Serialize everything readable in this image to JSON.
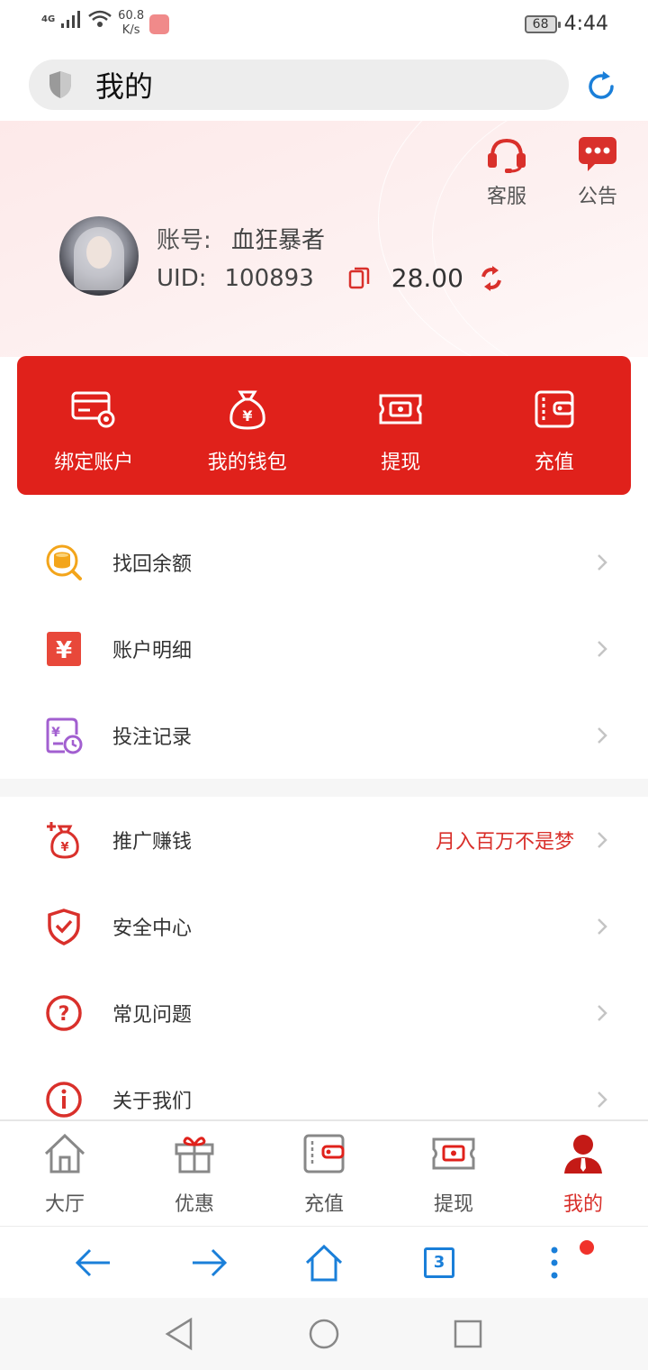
{
  "status_bar": {
    "network": "4G",
    "speed_value": "60.8",
    "speed_unit": "K/s",
    "battery": "68",
    "time": "4:44"
  },
  "url_bar": {
    "title": "我的"
  },
  "header": {
    "customer_service_label": "客服",
    "announcement_label": "公告",
    "account_label": "账号:",
    "account_name": "血狂暴者",
    "uid_label": "UID:",
    "uid_value": "100893",
    "balance": "28.00"
  },
  "quick_actions": [
    {
      "label": "绑定账户",
      "icon": "card-settings-icon"
    },
    {
      "label": "我的钱包",
      "icon": "money-bag-icon"
    },
    {
      "label": "提现",
      "icon": "ticket-cash-icon"
    },
    {
      "label": "充值",
      "icon": "wallet-icon"
    }
  ],
  "menu_group_1": [
    {
      "label": "找回余额",
      "icon": "coin-search-icon"
    },
    {
      "label": "账户明细",
      "icon": "yuan-doc-icon"
    },
    {
      "label": "投注记录",
      "icon": "record-clock-icon"
    }
  ],
  "menu_group_2": [
    {
      "label": "推广赚钱",
      "icon": "money-bag-plus-icon",
      "right_text": "月入百万不是梦"
    },
    {
      "label": "安全中心",
      "icon": "shield-check-icon",
      "right_text": ""
    },
    {
      "label": "常见问题",
      "icon": "question-circle-icon",
      "right_text": ""
    },
    {
      "label": "关于我们",
      "icon": "info-circle-icon",
      "right_text": ""
    }
  ],
  "tabbar": [
    {
      "label": "大厅",
      "icon": "home-icon",
      "active": false
    },
    {
      "label": "优惠",
      "icon": "gift-icon",
      "active": false
    },
    {
      "label": "充值",
      "icon": "wallet-icon",
      "active": false
    },
    {
      "label": "提现",
      "icon": "ticket-cash-icon",
      "active": false
    },
    {
      "label": "我的",
      "icon": "user-icon",
      "active": true
    }
  ],
  "browser_bar": {
    "tab_count": "3"
  },
  "colors": {
    "brand_red": "#e0211b",
    "accent_text_red": "#d9302b",
    "browser_blue": "#1a7fd9"
  }
}
